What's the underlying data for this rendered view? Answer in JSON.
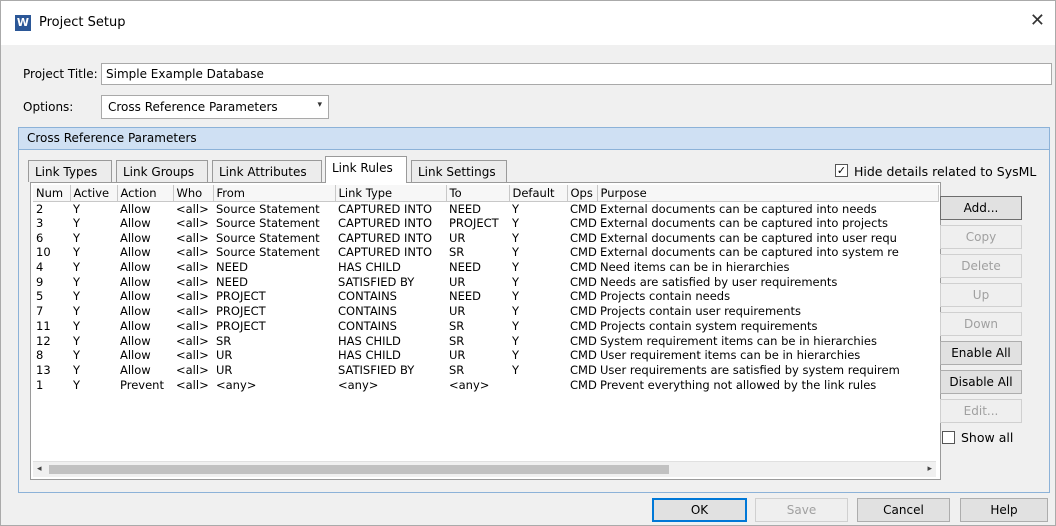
{
  "window": {
    "title": "Project Setup",
    "app_icon_letter": "W",
    "close_glyph": "✕"
  },
  "project": {
    "title_label": "Project Title:",
    "title_value": "Simple Example Database"
  },
  "options": {
    "label": "Options:",
    "selected": "Cross Reference Parameters",
    "arrow": "▾"
  },
  "group": {
    "header": "Cross Reference Parameters"
  },
  "tabs": [
    {
      "label": "Link Types"
    },
    {
      "label": "Link Groups"
    },
    {
      "label": "Link Attributes"
    },
    {
      "label": "Link Rules"
    },
    {
      "label": "Link Settings"
    }
  ],
  "active_tab": "Link Rules",
  "hide_sysml": {
    "label": "Hide details related to SysML",
    "checked": true,
    "mark": "✓"
  },
  "table": {
    "columns": [
      "Num",
      "Active",
      "Action",
      "Who",
      "From",
      "Link Type",
      "To",
      "Default",
      "Ops",
      "Purpose"
    ],
    "rows": [
      [
        "2",
        "Y",
        "Allow",
        "<all>",
        "Source Statement",
        "CAPTURED INTO",
        "NEED",
        "Y",
        "CMD",
        "External documents can be captured into needs"
      ],
      [
        "3",
        "Y",
        "Allow",
        "<all>",
        "Source Statement",
        "CAPTURED INTO",
        "PROJECT",
        "Y",
        "CMD",
        "External documents can be captured into projects"
      ],
      [
        "6",
        "Y",
        "Allow",
        "<all>",
        "Source Statement",
        "CAPTURED INTO",
        "UR",
        "Y",
        "CMD",
        "External documents can be captured into user requ"
      ],
      [
        "10",
        "Y",
        "Allow",
        "<all>",
        "Source Statement",
        "CAPTURED INTO",
        "SR",
        "Y",
        "CMD",
        "External documents can be captured into system re"
      ],
      [
        "4",
        "Y",
        "Allow",
        "<all>",
        "NEED",
        "HAS CHILD",
        "NEED",
        "Y",
        "CMD",
        "Need items can be in hierarchies"
      ],
      [
        "9",
        "Y",
        "Allow",
        "<all>",
        "NEED",
        "SATISFIED BY",
        "UR",
        "Y",
        "CMD",
        "Needs are satisfied by user requirements"
      ],
      [
        "5",
        "Y",
        "Allow",
        "<all>",
        "PROJECT",
        "CONTAINS",
        "NEED",
        "Y",
        "CMD",
        "Projects contain needs"
      ],
      [
        "7",
        "Y",
        "Allow",
        "<all>",
        "PROJECT",
        "CONTAINS",
        "UR",
        "Y",
        "CMD",
        "Projects contain user requirements"
      ],
      [
        "11",
        "Y",
        "Allow",
        "<all>",
        "PROJECT",
        "CONTAINS",
        "SR",
        "Y",
        "CMD",
        "Projects contain system requirements"
      ],
      [
        "12",
        "Y",
        "Allow",
        "<all>",
        "SR",
        "HAS CHILD",
        "SR",
        "Y",
        "CMD",
        "System requirement items can be in hierarchies"
      ],
      [
        "8",
        "Y",
        "Allow",
        "<all>",
        "UR",
        "HAS CHILD",
        "UR",
        "Y",
        "CMD",
        "User requirement items can be in hierarchies"
      ],
      [
        "13",
        "Y",
        "Allow",
        "<all>",
        "UR",
        "SATISFIED BY",
        "SR",
        "Y",
        "CMD",
        "User requirements are satisfied by system requirem"
      ],
      [
        "1",
        "Y",
        "Prevent",
        "<all>",
        "<any>",
        "<any>",
        "<any>",
        "",
        "CMD",
        "Prevent everything not allowed by the link rules"
      ]
    ],
    "scroll_left": "◂",
    "scroll_right": "▸"
  },
  "side_buttons": {
    "add": "Add...",
    "copy": "Copy",
    "delete": "Delete",
    "up": "Up",
    "down": "Down",
    "enable_all": "Enable All",
    "disable_all": "Disable All",
    "edit": "Edit..."
  },
  "show_all": {
    "label": "Show all",
    "checked": false
  },
  "footer": {
    "ok": "OK",
    "save": "Save",
    "cancel": "Cancel",
    "help": "Help"
  },
  "colors": {
    "group_header": "#cfe0f3",
    "group_border": "#8cb2d8",
    "app_icon": "#2b5797",
    "focus": "#0078d7"
  }
}
